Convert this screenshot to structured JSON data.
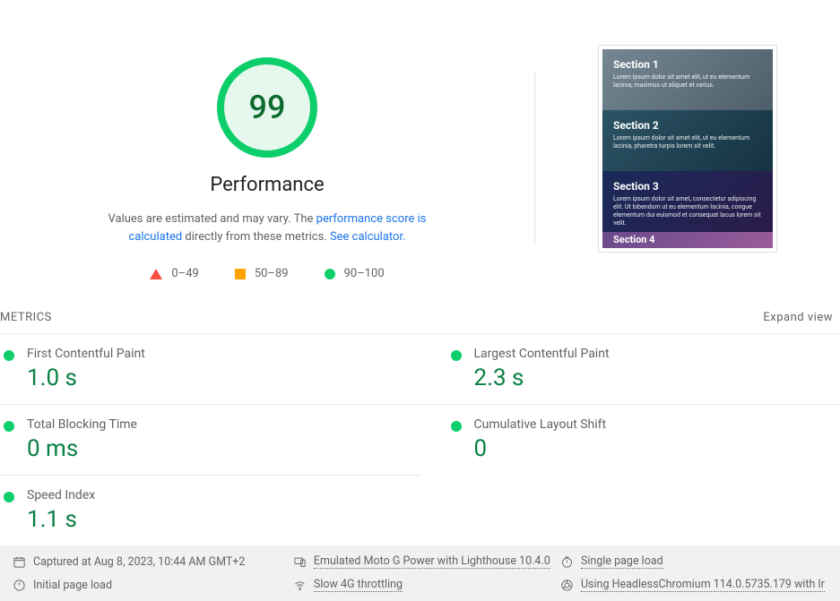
{
  "score": {
    "value": "99",
    "label": "Performance",
    "color_good": "#0cce6b",
    "bg_good": "#e6f7ed"
  },
  "disclaimer": {
    "prefix": "Values are estimated and may vary. The ",
    "link1": "performance score is calculated",
    "mid": " directly from these metrics. ",
    "link2": "See calculator."
  },
  "legend": {
    "fail": "0–49",
    "avg": "50–89",
    "pass": "90–100"
  },
  "thumbnail_sections": [
    {
      "title": "Section 1",
      "text": "Lorem ipsum dolor sit amet elit, ut eu elementum lacinia, maximus ut aliquet et varius."
    },
    {
      "title": "Section 2",
      "text": "Lorem ipsum dolor sit amet elit, ut eu elementum lacinia, pharetra turpis lorem sit velit."
    },
    {
      "title": "Section 3",
      "text": "Lorem ipsum dolor sit amet, consectetur adipiscing elit. Ut bibendum ut eu elementum lacinia, congue elementum dui euismod et consequat lacus lorem sit velit."
    },
    {
      "title": "Section 4",
      "text": ""
    }
  ],
  "metrics_header": {
    "title": "METRICS",
    "expand": "Expand view"
  },
  "metrics": [
    {
      "name": "First Contentful Paint",
      "value": "1.0 s",
      "status": "pass"
    },
    {
      "name": "Largest Contentful Paint",
      "value": "2.3 s",
      "status": "pass"
    },
    {
      "name": "Total Blocking Time",
      "value": "0 ms",
      "status": "pass"
    },
    {
      "name": "Cumulative Layout Shift",
      "value": "0",
      "status": "pass"
    },
    {
      "name": "Speed Index",
      "value": "1.1 s",
      "status": "pass"
    }
  ],
  "footer": {
    "captured": "Captured at Aug 8, 2023, 10:44 AM GMT+2",
    "emulated": "Emulated Moto G Power with Lighthouse 10.4.0",
    "single": "Single page load",
    "initial": "Initial page load",
    "throttling": "Slow 4G throttling",
    "browser": "Using HeadlessChromium 114.0.5735.179 with lr"
  }
}
